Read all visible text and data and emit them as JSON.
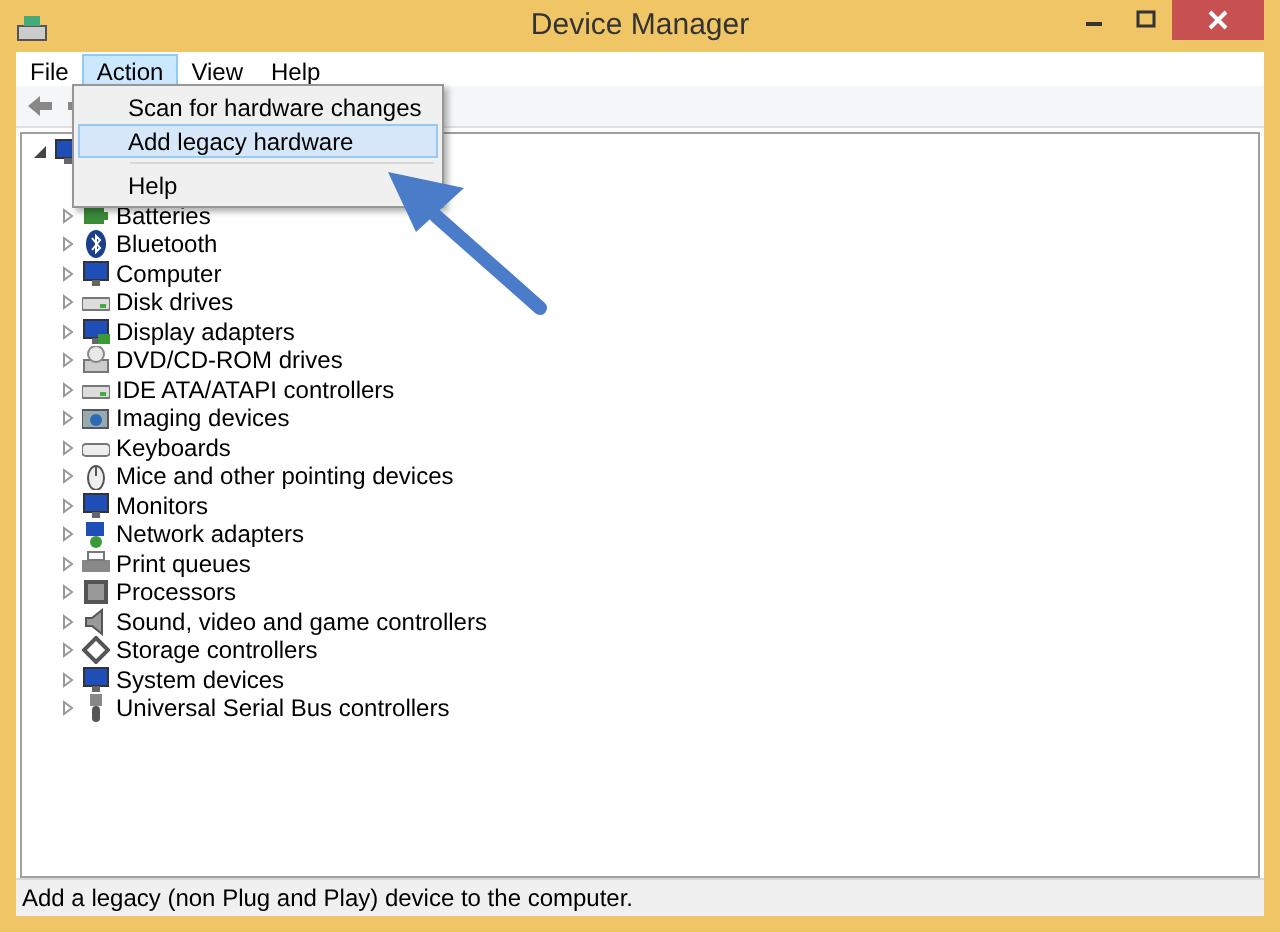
{
  "window": {
    "title": "Device Manager"
  },
  "menubar": [
    {
      "label": "File",
      "selected": false
    },
    {
      "label": "Action",
      "selected": true
    },
    {
      "label": "View",
      "selected": false
    },
    {
      "label": "Help",
      "selected": false
    }
  ],
  "menu": [
    {
      "label": "Scan for hardware changes",
      "selected": false
    },
    {
      "label": "Add legacy hardware",
      "selected": true
    },
    {
      "kind": "separator"
    },
    {
      "label": "Help",
      "selected": false
    }
  ],
  "tree": {
    "expanded": true,
    "children": [
      {
        "label": "Batteries",
        "kind": "battery",
        "expanded": false
      },
      {
        "label": "Bluetooth",
        "kind": "bluetooth",
        "expanded": false
      },
      {
        "label": "Computer",
        "kind": "computer",
        "expanded": false
      },
      {
        "label": "Disk drives",
        "kind": "disk",
        "expanded": false
      },
      {
        "label": "Display adapters",
        "kind": "display",
        "expanded": false
      },
      {
        "label": "DVD/CD-ROM drives",
        "kind": "dvd",
        "expanded": false
      },
      {
        "label": "IDE ATA/ATAPI controllers",
        "kind": "disk",
        "expanded": false
      },
      {
        "label": "Imaging devices",
        "kind": "camera",
        "expanded": false
      },
      {
        "label": "Keyboards",
        "kind": "keyboard",
        "expanded": false
      },
      {
        "label": "Mice and other pointing devices",
        "kind": "mouse",
        "expanded": false
      },
      {
        "label": "Monitors",
        "kind": "monitor",
        "expanded": false
      },
      {
        "label": "Network adapters",
        "kind": "network",
        "expanded": false
      },
      {
        "label": "Print queues",
        "kind": "printer",
        "expanded": false
      },
      {
        "label": "Processors",
        "kind": "chip",
        "expanded": false
      },
      {
        "label": "Sound, video and game controllers",
        "kind": "speaker",
        "expanded": false
      },
      {
        "label": "Storage controllers",
        "kind": "storage",
        "expanded": false
      },
      {
        "label": "System devices",
        "kind": "computer",
        "expanded": false
      },
      {
        "label": "Universal Serial Bus controllers",
        "kind": "usb",
        "expanded": false
      }
    ]
  },
  "status_bar": "Add a legacy (non Plug and Play) device to the computer."
}
